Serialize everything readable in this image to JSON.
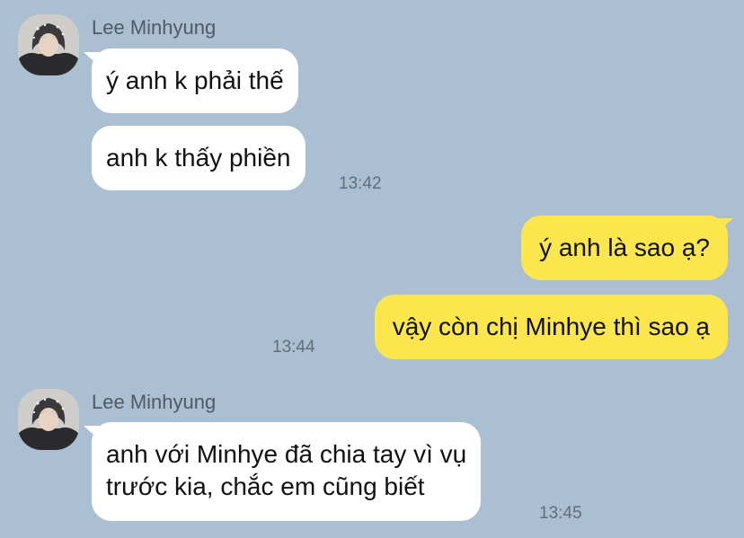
{
  "groups": [
    {
      "sender": "Lee Minhyung",
      "messages": [
        "ý anh k phải thế",
        "anh k thấy phiền"
      ],
      "time": "13:42"
    },
    {
      "sender": "",
      "messages": [
        "ý anh là sao ạ?",
        "vậy còn chị Minhye thì sao ạ"
      ],
      "time": "13:44"
    },
    {
      "sender": "Lee Minhyung",
      "messages": [
        "anh với Minhye đã chia tay vì vụ\ntrước kia, chắc em cũng biết"
      ],
      "time": "13:45"
    }
  ],
  "icons": {
    "avatar": "profile-avatar-photo"
  },
  "colors": {
    "background": "#abbfd3",
    "incoming_bubble": "#ffffff",
    "outgoing_bubble": "#fbe74d",
    "text": "#111111",
    "meta_text": "#626d78"
  }
}
